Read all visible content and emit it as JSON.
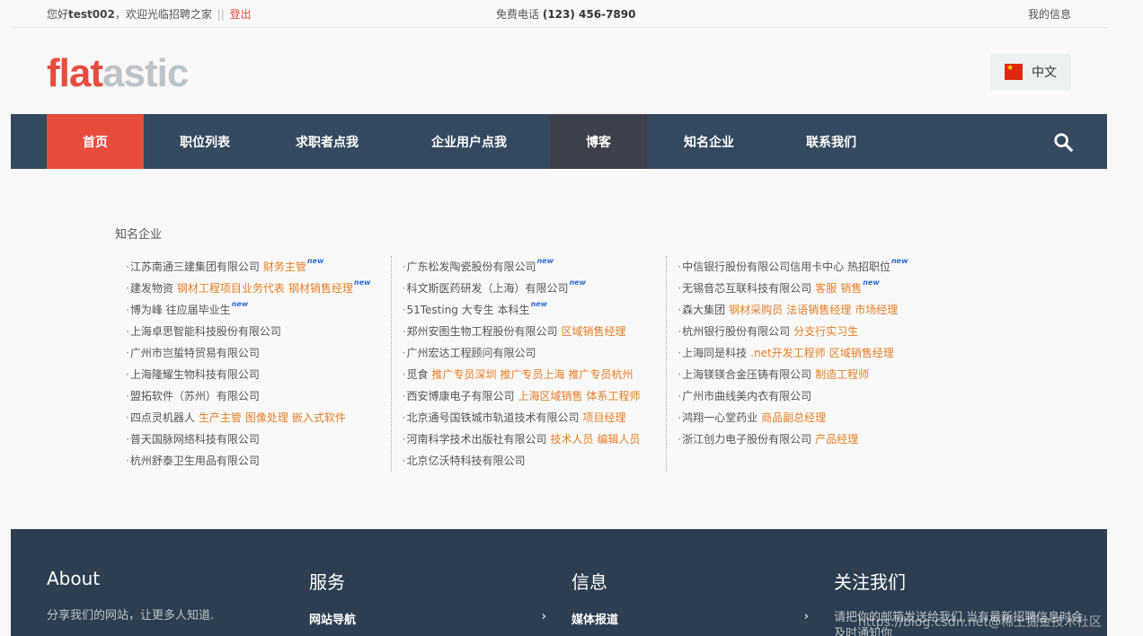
{
  "topbar": {
    "greeting_prefix": "您好",
    "username": "test002",
    "greeting_suffix": "，欢迎光临招聘之家",
    "separator": "||",
    "logout": "登出",
    "phone_label": "免费电话",
    "phone_number": "(123) 456-7890",
    "my_info": "我的信息"
  },
  "header": {
    "logo_part1": "flat",
    "logo_part2": "astic",
    "language": "中文"
  },
  "nav": {
    "items": [
      "首页",
      "职位列表",
      "求职者点我",
      "企业用户点我",
      "博客",
      "知名企业",
      "联系我们"
    ]
  },
  "companies": {
    "title": "知名企业",
    "col1": [
      {
        "name": "江苏南通三建集团有限公司",
        "jobs": [
          "财务主管"
        ],
        "new": "new"
      },
      {
        "name": "建发物资",
        "jobs": [
          "钢材工程项目业务代表",
          "钢材销售经理"
        ],
        "new": "new"
      },
      {
        "name": "博为峰 往应届毕业生",
        "jobs": [],
        "new": "new"
      },
      {
        "name": "上海卓思智能科技股份有限公司",
        "jobs": []
      },
      {
        "name": "广州市岂蜇特贸易有限公司",
        "jobs": []
      },
      {
        "name": "上海隆耀生物科技有限公司",
        "jobs": []
      },
      {
        "name": "盟拓软件（苏州）有限公司",
        "jobs": []
      },
      {
        "name": "四点灵机器人",
        "jobs": [
          "生产主管",
          "图像处理",
          "嵌入式软件"
        ]
      },
      {
        "name": "普天国脉网络科技有限公司",
        "jobs": []
      },
      {
        "name": "杭州舒泰卫生用品有限公司",
        "jobs": []
      }
    ],
    "col2": [
      {
        "name": "广东松发陶瓷股份有限公司",
        "jobs": [],
        "new": "new"
      },
      {
        "name": "科文斯医药研发（上海）有限公司",
        "jobs": [],
        "new": "new"
      },
      {
        "name": "51Testing 大专生 本科生",
        "jobs": [],
        "new": "new"
      },
      {
        "name": "郑州安图生物工程股份有限公司",
        "jobs": [
          "区域销售经理"
        ]
      },
      {
        "name": "广州宏达工程顾问有限公司",
        "jobs": []
      },
      {
        "name": "觅食",
        "jobs": [
          "推广专员深圳",
          "推广专员上海",
          "推广专员杭州"
        ]
      },
      {
        "name": "西安博康电子有限公司",
        "jobs": [
          "上海区域销售",
          "体系工程师"
        ]
      },
      {
        "name": "北京通号国铁城市轨道技术有限公司",
        "jobs": [
          "项目经理"
        ]
      },
      {
        "name": "河南科学技术出版社有限公司",
        "jobs": [
          "技术人员",
          "编辑人员"
        ]
      },
      {
        "name": "北京亿沃特科技有限公司",
        "jobs": []
      }
    ],
    "col3": [
      {
        "name": "中信银行股份有限公司信用卡中心 热招职位",
        "jobs": [],
        "new": "new"
      },
      {
        "name": "无锡音芯互联科技有限公司",
        "jobs": [
          "客服",
          "销售"
        ],
        "new": "new"
      },
      {
        "name": "森大集团",
        "jobs": [
          "钢材采购员",
          "法语销售经理",
          "市场经理"
        ]
      },
      {
        "name": "杭州银行股份有限公司",
        "jobs": [
          "分支行实习生"
        ]
      },
      {
        "name": "上海同是科技",
        "jobs": [
          ".net开发工程师",
          "区域销售经理"
        ]
      },
      {
        "name": "上海镁镁合金压铸有限公司",
        "jobs": [
          "制造工程师"
        ]
      },
      {
        "name": "广州市曲线美内衣有限公司",
        "jobs": []
      },
      {
        "name": "鸿翔一心堂药业",
        "jobs": [
          "商品副总经理"
        ]
      },
      {
        "name": "浙江创力电子股份有限公司",
        "jobs": [
          "产品经理"
        ]
      }
    ]
  },
  "footer": {
    "about_title": "About",
    "about_desc": "分享我们的网站，让更多人知道.",
    "service_title": "服务",
    "service_link": "网站导航",
    "info_title": "信息",
    "info_link": "媒体报道",
    "follow_title": "关注我们",
    "follow_desc": "请把你的邮箱发送给我们,当有最新招聘信息时会及时通知你",
    "chevron": "›",
    "watermark": "https://blog.csdn.net@稀土掘金技术社区"
  },
  "colors": {
    "accent": "#e74c3c",
    "nav_bg": "#34495e",
    "footer_bg": "#2c3e50",
    "job_link": "#e67e22",
    "new_badge": "#2b6cd6"
  },
  "icons": {
    "search": "search-icon",
    "flag": "china-flag-icon"
  }
}
